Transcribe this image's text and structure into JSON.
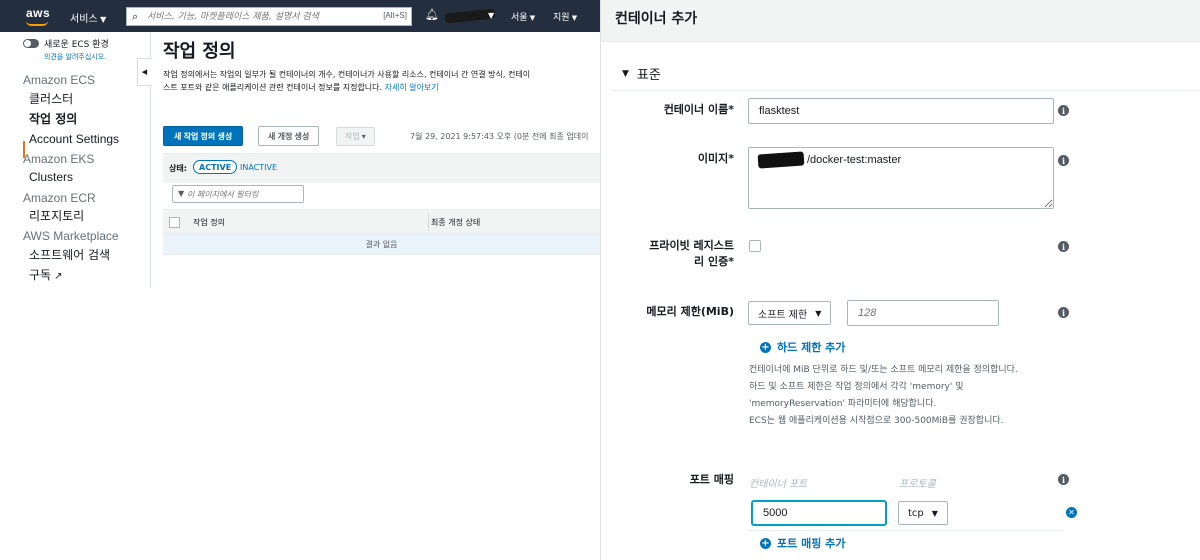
{
  "left_panel": {
    "topnav": {
      "logo": "aws",
      "services_label": "서비스",
      "search_placeholder": "서비스, 기능, 마켓플레이스 제품, 설명서 검색",
      "search_shortcut": "[Alt+S]",
      "region_label": "서울",
      "support_label": "지원"
    },
    "sidebar": {
      "new_experience_label": "새로운 ECS 환경",
      "feedback_link": "의견을 알려주십시오.",
      "sections": [
        {
          "title": "Amazon ECS",
          "items": [
            "클러스터",
            "작업 정의",
            "Account Settings"
          ]
        },
        {
          "title": "Amazon EKS",
          "items": [
            "Clusters"
          ]
        },
        {
          "title": "Amazon ECR",
          "items": [
            "리포지토리"
          ]
        },
        {
          "title": "AWS Marketplace",
          "items": [
            "소프트웨어 검색",
            "구독"
          ]
        }
      ],
      "active_item": "작업 정의"
    },
    "main": {
      "title": "작업 정의",
      "description_line1": "작업 정의에서는 작업의 일부가 될 컨테이너의 개수, 컨테이너가 사용할 리소스, 컨테이너 간 연결 방식, 컨테이",
      "description_line2": "스트 포트와 같은 애플리케이션 관련 컨테이너 정보를 지정합니다.",
      "learn_more": "자세히 알아보기",
      "create_button": "새 작업 정의 생성",
      "revision_button": "새 개정 생성",
      "actions_button": "작업",
      "last_updated": "7월 29, 2021 9:57:43 오후 (0분 전에 최종 업데이",
      "status_label": "상태:",
      "status_active": "ACTIVE",
      "status_inactive": "INACTIVE",
      "filter_placeholder": "이 페이지에서 필터링",
      "columns": [
        "작업 정의",
        "최종 개정 상태"
      ],
      "empty_text": "결과 없음"
    }
  },
  "right_panel": {
    "title": "컨테이너 추가",
    "section_title": "표준",
    "container_name": {
      "label": "컨테이너 이름*",
      "value": "flasktest"
    },
    "image": {
      "label": "이미지*",
      "value": "/docker-test:master"
    },
    "private_registry": {
      "label_line1": "프라이빗 레지스트",
      "label_line2": "리 인증*",
      "checked": false
    },
    "memory": {
      "label": "메모리 제한(MiB)",
      "limit_type": "소프트 제한",
      "placeholder": "128",
      "add_hard_limit": "하드 제한 추가",
      "help_lines": [
        "컨테이너에 MiB 단위로 하드 및/또는 소프트 메모리 제한을 정의합니다.",
        "하드 및 소프트 제한은 작업 정의에서 각각 'memory' 및",
        "'memoryReservation' 파라미터에 해당합니다.",
        "ECS는 웹 애플리케이션용 시작점으로 300-500MiB를 권장합니다."
      ]
    },
    "port_mapping": {
      "label": "포트 매핑",
      "container_port_header": "컨테이너 포트",
      "protocol_header": "프로토콜",
      "container_port_value": "5000",
      "protocol_value": "tcp",
      "add_port_mapping": "포트 매핑 추가"
    },
    "info_icon_glyph": "i"
  }
}
